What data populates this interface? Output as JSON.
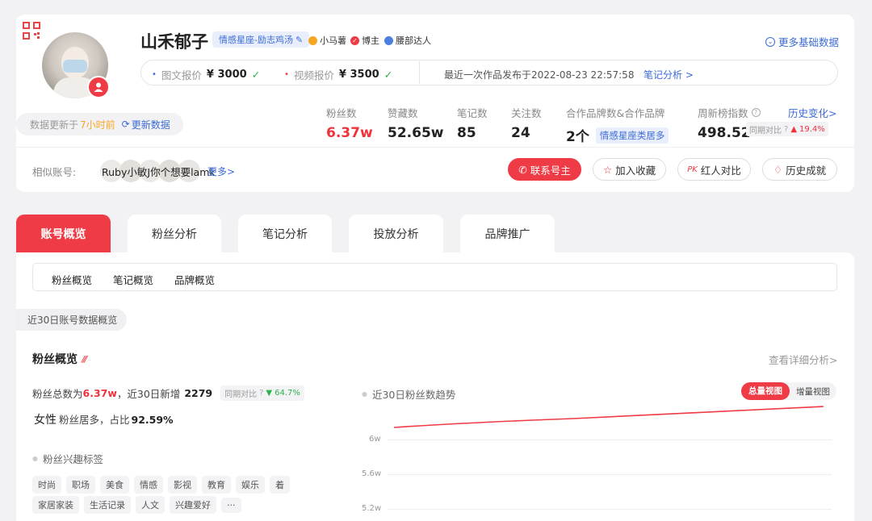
{
  "profile": {
    "name": "山禾郁子",
    "category_tag": "情感星座-励志鸡汤",
    "badges": [
      "小马薯",
      "博主",
      "腰部达人"
    ],
    "more_data_link": "更多基础数据",
    "text_price_label": "图文报价",
    "text_price_value": "¥ 3000",
    "video_price_label": "视频报价",
    "video_price_value": "¥ 3500",
    "last_post_text": "最近一次作品发布于2022-08-23 22:57:58",
    "note_analysis_link": "笔记分析 >",
    "update_prefix": "数据更新于",
    "update_time": "7小时前",
    "update_button": "更新数据"
  },
  "stats": {
    "fans_label": "粉丝数",
    "fans_value": "6.37w",
    "likes_label": "赞藏数",
    "likes_value": "52.65w",
    "notes_label": "笔记数",
    "notes_value": "85",
    "follow_label": "关注数",
    "follow_value": "24",
    "brand_label": "合作品牌数&合作品牌",
    "brand_value": "2个",
    "brand_tag": "情感星座类居多",
    "weekly_label": "周新榜指数",
    "weekly_value": "498.52",
    "history_link": "历史变化>",
    "yoy_label": "同期对比",
    "yoy_value": "19.4%"
  },
  "similar": {
    "label": "相似账号:",
    "names": "Ruby小敏J你个想要lamk",
    "more": "更多>"
  },
  "actions": {
    "contact": "联系号主",
    "favorite": "加入收藏",
    "compare": "红人对比",
    "history": "历史成就"
  },
  "tabs": [
    "账号概览",
    "粉丝分析",
    "笔记分析",
    "投放分析",
    "品牌推广"
  ],
  "subtabs": [
    "粉丝概览",
    "笔记概览",
    "品牌概览"
  ],
  "section_badge": "近30日账号数据概览",
  "fans_overview": {
    "title": "粉丝概览",
    "detail_link": "查看详细分析>",
    "total_prefix": "粉丝总数为",
    "total_value": "6.37w",
    "new_prefix": "，近30日新增",
    "new_value": "2279",
    "yoy_label": "同期对比",
    "yoy_value": "64.7%",
    "gender_main": "女性",
    "gender_text": "粉丝居多，占比",
    "gender_pct": "92.59%",
    "interest_title": "粉丝兴趣标签",
    "interest_tags_row1": [
      "时尚",
      "职场",
      "美食",
      "情感",
      "影视",
      "教育",
      "娱乐",
      "着"
    ],
    "interest_tags_row2": [
      "家居家装",
      "生活记录",
      "人文",
      "兴趣爱好",
      "···"
    ]
  },
  "trend": {
    "title": "近30日粉丝数趋势",
    "view_total": "总量视图",
    "view_incr": "增量视图",
    "y_ticks": [
      "6w",
      "5.6w",
      "5.2w"
    ]
  },
  "colors": {
    "accent": "#ef3b45",
    "tag_bg": "#e8eefc",
    "tag_fg": "#3b6bd6"
  }
}
